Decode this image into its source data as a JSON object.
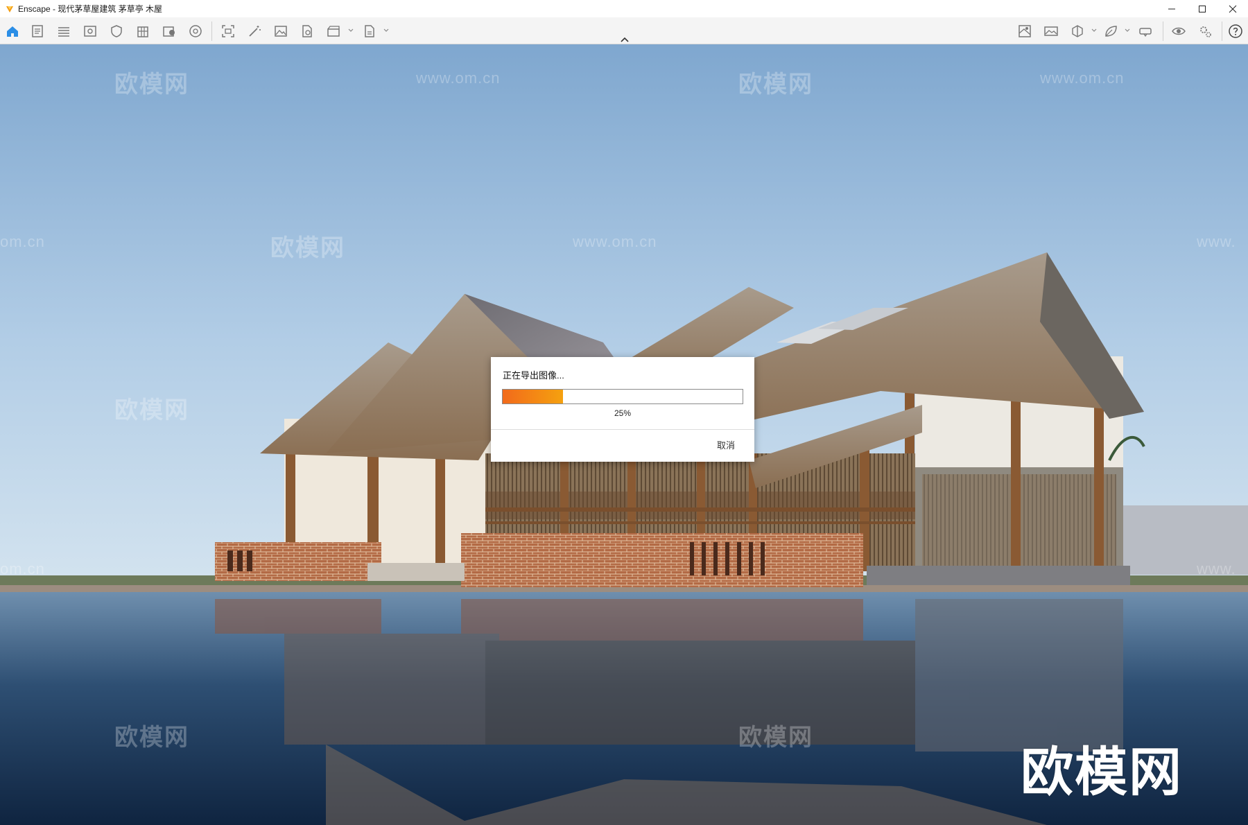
{
  "window": {
    "title": "Enscape - 现代茅草屋建筑 茅草亭 木屋",
    "controls": [
      "minimize-icon",
      "maximize-icon",
      "close-icon"
    ]
  },
  "toolbar": {
    "left_icons": [
      "home-icon",
      "document-icon",
      "bim-icon",
      "view-icon",
      "shield-icon",
      "building-icon",
      "asset-library-icon",
      "material-icon",
      "screenshot-icon",
      "magic-wand-icon",
      "image-icon",
      "export-icon",
      "video-camera-icon",
      "batch-render-icon"
    ],
    "right_icons": [
      "map-icon",
      "panorama-icon",
      "cube-icon",
      "leaf-icon",
      "vr-headset-icon",
      "eye-icon",
      "settings-icon",
      "help-icon"
    ],
    "accent": "#2b8ee6"
  },
  "dialog": {
    "title": "正在导出图像...",
    "progress": 0.25,
    "progress_text": "25%",
    "cancel_label": "取消"
  },
  "watermarks": {
    "logo": "欧模网",
    "url": "www.om.cn",
    "partial_url": "om.cn",
    "partial_url_right": "www.",
    "big_logo": "欧模网"
  },
  "colors": {
    "progress_start": "#f26a1b",
    "progress_end": "#f5a10f"
  }
}
